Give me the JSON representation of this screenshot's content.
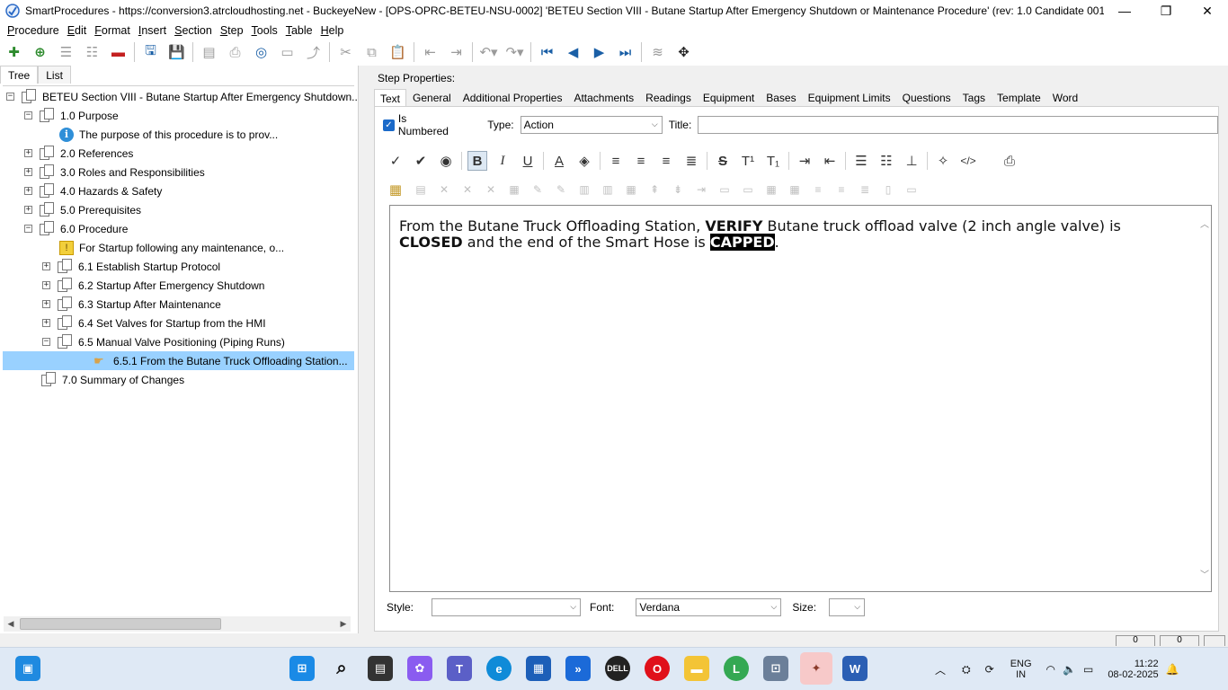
{
  "window": {
    "title": "SmartProcedures - https://conversion3.atrcloudhosting.net - BuckeyeNew - [OPS-OPRC-BETEU-NSU-0002] 'BETEU Section VIII - Butane Startup After Emergency Shutdown or Maintenance Procedure' (rev: 1.0 Candidate 001)*",
    "minimize": "—",
    "maximize": "❐",
    "close": "✕"
  },
  "menu": {
    "items": [
      {
        "label": "Procedure",
        "u": "P",
        "rest": "rocedure"
      },
      {
        "label": "Edit",
        "u": "E",
        "rest": "dit"
      },
      {
        "label": "Format",
        "u": "F",
        "rest": "ormat"
      },
      {
        "label": "Insert",
        "u": "I",
        "rest": "nsert"
      },
      {
        "label": "Section",
        "u": "S",
        "rest": "ection"
      },
      {
        "label": "Step",
        "u": "S",
        "rest": "tep"
      },
      {
        "label": "Tools",
        "u": "T",
        "rest": "ools"
      },
      {
        "label": "Table",
        "u": "T",
        "rest": "able"
      },
      {
        "label": "Help",
        "u": "H",
        "rest": "elp"
      }
    ]
  },
  "left": {
    "tabs": [
      "Tree",
      "List"
    ],
    "tree": [
      {
        "label": "BETEU Section VIII - Butane Startup After Emergency Shutdown...",
        "icon": "doc",
        "expander": "−",
        "level": 0
      },
      {
        "label": "1.0 Purpose",
        "icon": "doc",
        "expander": "−",
        "level": 1
      },
      {
        "label": "The purpose of this procedure is to prov...",
        "icon": "info",
        "expander": "",
        "level": 2
      },
      {
        "label": "2.0 References",
        "icon": "doc",
        "expander": "+",
        "level": 1
      },
      {
        "label": "3.0 Roles and Responsibilities",
        "icon": "doc",
        "expander": "+",
        "level": 1
      },
      {
        "label": "4.0 Hazards & Safety",
        "icon": "doc",
        "expander": "+",
        "level": 1
      },
      {
        "label": "5.0 Prerequisites",
        "icon": "doc",
        "expander": "+",
        "level": 1
      },
      {
        "label": "6.0 Procedure",
        "icon": "doc",
        "expander": "−",
        "level": 1
      },
      {
        "label": "For Startup following any maintenance, o...",
        "icon": "warn",
        "expander": "",
        "level": 2
      },
      {
        "label": "6.1 Establish Startup Protocol",
        "icon": "doc",
        "expander": "+",
        "level": 2
      },
      {
        "label": "6.2 Startup After Emergency Shutdown",
        "icon": "doc",
        "expander": "+",
        "level": 2
      },
      {
        "label": "6.3 Startup After Maintenance",
        "icon": "doc",
        "expander": "+",
        "level": 2
      },
      {
        "label": "6.4 Set Valves for Startup from the HMI",
        "icon": "doc",
        "expander": "+",
        "level": 2
      },
      {
        "label": "6.5 Manual Valve Positioning (Piping Runs)",
        "icon": "doc",
        "expander": "−",
        "level": 2
      },
      {
        "label": "6.5.1 From the Butane Truck Offloading Station...",
        "icon": "hand",
        "expander": "",
        "level": 3,
        "selected": true
      },
      {
        "label": "7.0 Summary of Changes",
        "icon": "doc",
        "expander": "",
        "level": 1
      }
    ]
  },
  "right": {
    "heading": "Step Properties:",
    "tabs": [
      "Text",
      "General",
      "Additional Properties",
      "Attachments",
      "Readings",
      "Equipment",
      "Bases",
      "Equipment Limits",
      "Questions",
      "Tags",
      "Template",
      "Word"
    ],
    "is_numbered_label": "Is Numbered",
    "type_label": "Type:",
    "type_value": "Action",
    "title_label": "Title:",
    "title_value": "",
    "content": {
      "p1": "From the Butane Truck Offloading Station, ",
      "b1": "VERIFY",
      "p2": " Butane truck offload valve (2 inch angle valve) is ",
      "b2": "CLOSED",
      "p3": " and the end of the Smart Hose is ",
      "hl": "CAPPED",
      "p4": "."
    },
    "style_label": "Style:",
    "style_value": "",
    "font_label": "Font:",
    "font_value": "Verdana",
    "size_label": "Size:",
    "size_value": ""
  },
  "status": {
    "cell1": "0",
    "cell2": "0"
  },
  "tray": {
    "lang1": "ENG",
    "lang2": "IN",
    "time": "11:22",
    "date": "08-02-2025",
    "chrome_badge": "L"
  },
  "colors": {
    "selection": "#99d1ff",
    "accent": "#1b6ac9",
    "taskbar": "#dfe9f5"
  }
}
